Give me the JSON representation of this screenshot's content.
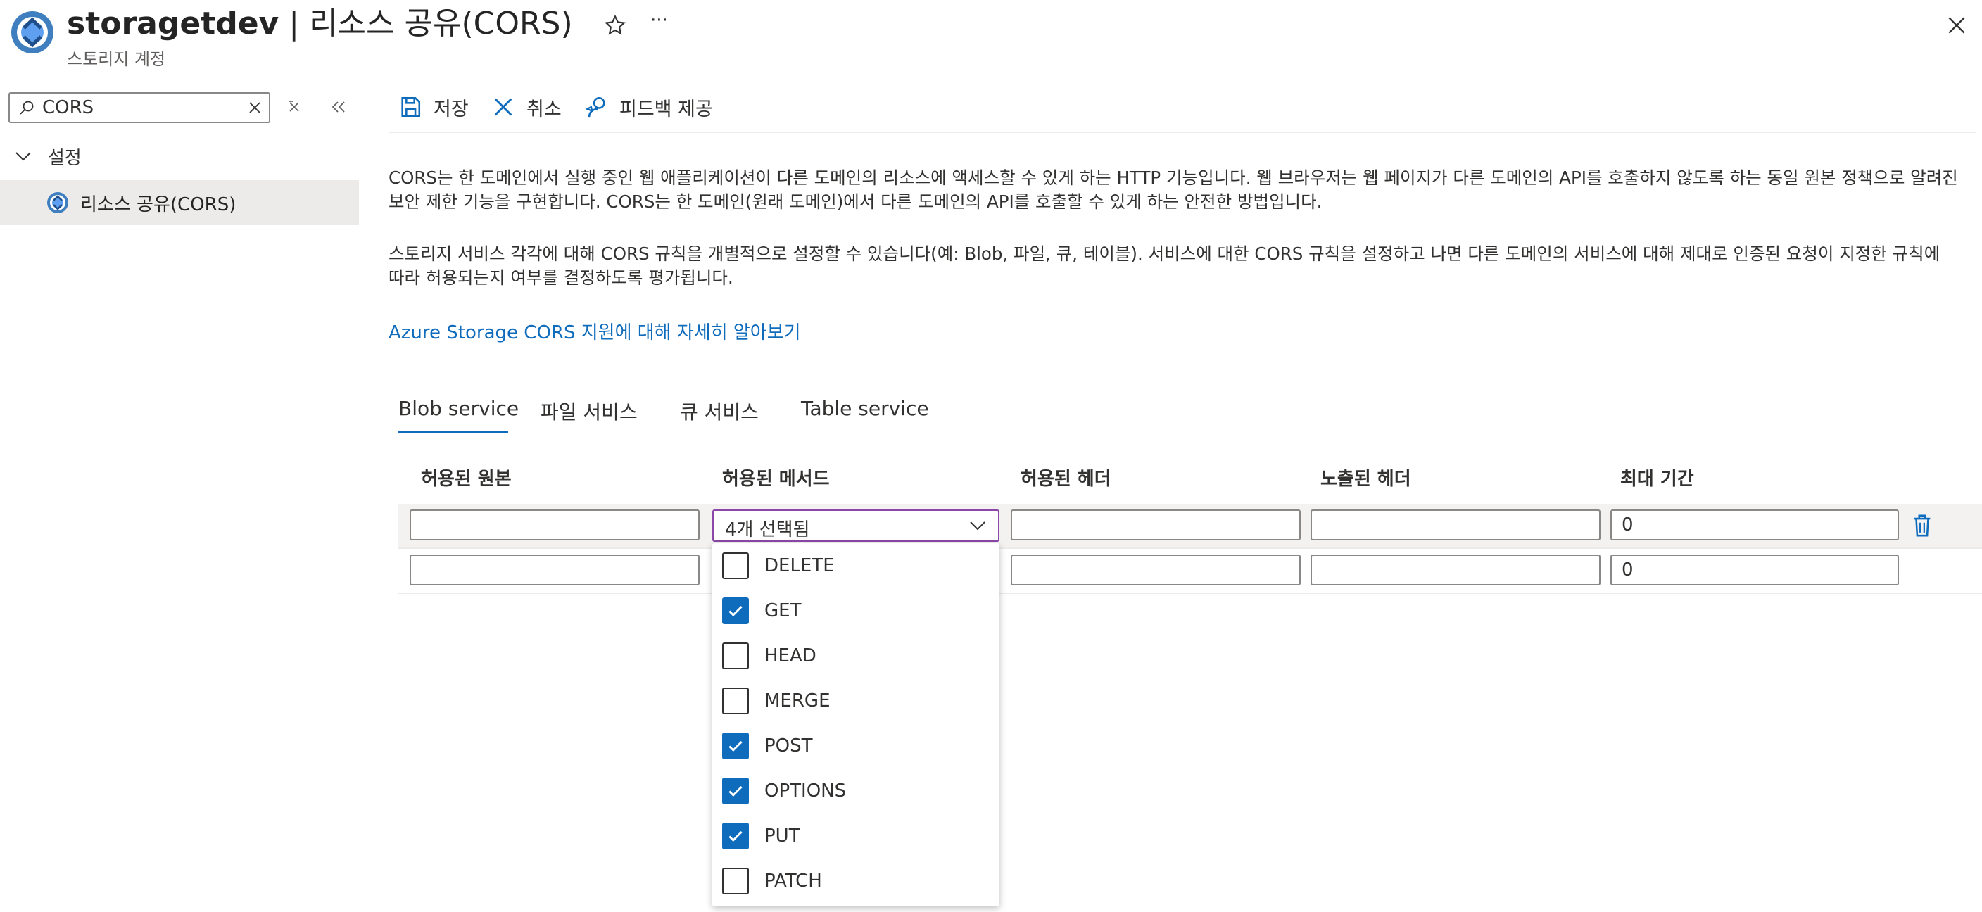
{
  "header": {
    "resource_name": "storagetdev",
    "separator": "|",
    "page_name": "리소스 공유(CORS)",
    "subtitle": "스토리지 계정",
    "more_label": "···"
  },
  "nav": {
    "search_value": "CORS",
    "group_label": "설정",
    "active_item": "리소스 공유(CORS)"
  },
  "toolbar": {
    "save": "저장",
    "discard": "취소",
    "feedback": "피드백 제공"
  },
  "description": {
    "para1": "CORS는 한 도메인에서 실행 중인 웹 애플리케이션이 다른 도메인의 리소스에 액세스할 수 있게 하는 HTTP 기능입니다. 웹 브라우저는 웹 페이지가 다른 도메인의 API를 호출하지 않도록 하는 동일 원본 정책으로 알려진 보안 제한 기능을 구현합니다. CORS는 한 도메인(원래 도메인)에서 다른 도메인의 API를 호출할 수 있게 하는 안전한 방법입니다.",
    "para2": "스토리지 서비스 각각에 대해 CORS 규칙을 개별적으로 설정할 수 있습니다(예: Blob, 파일, 큐, 테이블). 서비스에 대한 CORS 규칙을 설정하고 나면 다른 도메인의 서비스에 대해 제대로 인증된 요청이 지정한 규칙에 따라 허용되는지 여부를 결정하도록 평가됩니다.",
    "learn_more": "Azure Storage CORS 지원에 대해 자세히 알아보기"
  },
  "tabs": [
    "Blob service",
    "파일 서비스",
    "큐 서비스",
    "Table service"
  ],
  "table": {
    "columns": [
      "허용된 원본",
      "허용된 메서드",
      "허용된 헤더",
      "노출된 헤더",
      "최대 기간"
    ],
    "rows": [
      {
        "origins": "",
        "methods": "4개 선택됨",
        "allowed_headers": "",
        "exposed_headers": "",
        "max_age": "0"
      },
      {
        "origins": "",
        "methods": "",
        "allowed_headers": "",
        "exposed_headers": "",
        "max_age": "0"
      }
    ]
  },
  "methods_dropdown": {
    "options": [
      {
        "label": "DELETE",
        "checked": false
      },
      {
        "label": "GET",
        "checked": true
      },
      {
        "label": "HEAD",
        "checked": false
      },
      {
        "label": "MERGE",
        "checked": false
      },
      {
        "label": "POST",
        "checked": true
      },
      {
        "label": "OPTIONS",
        "checked": true
      },
      {
        "label": "PUT",
        "checked": true
      },
      {
        "label": "PATCH",
        "checked": false
      }
    ]
  },
  "colors": {
    "accent": "#0f6cbd",
    "select_border": "#8b48a8",
    "delete_icon": "#0f6cbd"
  }
}
